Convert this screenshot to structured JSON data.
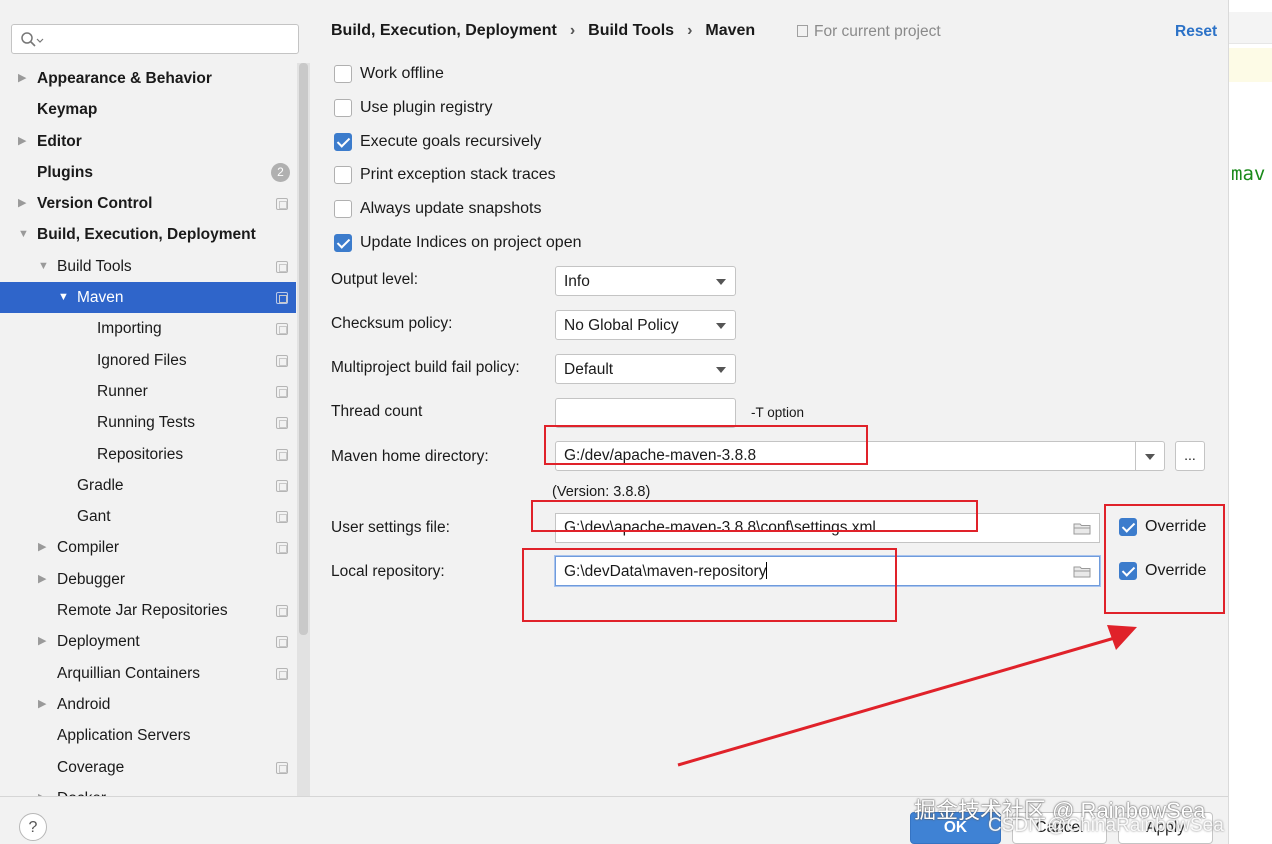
{
  "sidebar": {
    "search": {
      "placeholder": ""
    },
    "items": [
      {
        "label": "Appearance & Behavior",
        "bold": true,
        "arrow": "right",
        "depth": 0
      },
      {
        "label": "Keymap",
        "bold": true,
        "arrow": "",
        "depth": 0
      },
      {
        "label": "Editor",
        "bold": true,
        "arrow": "right",
        "depth": 0
      },
      {
        "label": "Plugins",
        "bold": true,
        "arrow": "",
        "depth": 0,
        "badge": "2"
      },
      {
        "label": "Version Control",
        "bold": true,
        "arrow": "right",
        "depth": 0,
        "icon": true
      },
      {
        "label": "Build, Execution, Deployment",
        "bold": true,
        "arrow": "down",
        "depth": 0
      },
      {
        "label": "Build Tools",
        "bold": false,
        "arrow": "down",
        "depth": 1,
        "icon": true
      },
      {
        "label": "Maven",
        "bold": false,
        "arrow": "down",
        "depth": 2,
        "icon": true,
        "selected": true
      },
      {
        "label": "Importing",
        "bold": false,
        "arrow": "",
        "depth": 3,
        "icon": true
      },
      {
        "label": "Ignored Files",
        "bold": false,
        "arrow": "",
        "depth": 3,
        "icon": true
      },
      {
        "label": "Runner",
        "bold": false,
        "arrow": "",
        "depth": 3,
        "icon": true
      },
      {
        "label": "Running Tests",
        "bold": false,
        "arrow": "",
        "depth": 3,
        "icon": true
      },
      {
        "label": "Repositories",
        "bold": false,
        "arrow": "",
        "depth": 3,
        "icon": true
      },
      {
        "label": "Gradle",
        "bold": false,
        "arrow": "",
        "depth": 2,
        "icon": true
      },
      {
        "label": "Gant",
        "bold": false,
        "arrow": "",
        "depth": 2,
        "icon": true
      },
      {
        "label": "Compiler",
        "bold": false,
        "arrow": "right",
        "depth": 1,
        "icon": true
      },
      {
        "label": "Debugger",
        "bold": false,
        "arrow": "right",
        "depth": 1
      },
      {
        "label": "Remote Jar Repositories",
        "bold": false,
        "arrow": "",
        "depth": 1,
        "icon": true
      },
      {
        "label": "Deployment",
        "bold": false,
        "arrow": "right",
        "depth": 1,
        "icon": true
      },
      {
        "label": "Arquillian Containers",
        "bold": false,
        "arrow": "",
        "depth": 1,
        "icon": true
      },
      {
        "label": "Android",
        "bold": false,
        "arrow": "right",
        "depth": 1
      },
      {
        "label": "Application Servers",
        "bold": false,
        "arrow": "",
        "depth": 1
      },
      {
        "label": "Coverage",
        "bold": false,
        "arrow": "",
        "depth": 1,
        "icon": true
      },
      {
        "label": "Docker",
        "bold": false,
        "arrow": "right",
        "depth": 1
      }
    ]
  },
  "breadcrumb": {
    "parts": [
      "Build, Execution, Deployment",
      "Build Tools",
      "Maven"
    ],
    "separator": "›",
    "scope": "For current project",
    "reset_label": "Reset"
  },
  "options": {
    "work_offline": {
      "label": "Work offline",
      "checked": false
    },
    "use_plugin_registry": {
      "label": "Use plugin registry",
      "checked": false
    },
    "execute_goals_recursively": {
      "label": "Execute goals recursively",
      "checked": true
    },
    "print_exception_stack_traces": {
      "label": "Print exception stack traces",
      "checked": false
    },
    "always_update_snapshots": {
      "label": "Always update snapshots",
      "checked": false
    },
    "update_indices": {
      "label": "Update Indices on project open",
      "checked": true
    }
  },
  "fields": {
    "output_level": {
      "label": "Output level:",
      "value": "Info"
    },
    "checksum_policy": {
      "label": "Checksum policy:",
      "value": "No Global Policy"
    },
    "fail_policy": {
      "label": "Multiproject build fail policy:",
      "value": "Default"
    },
    "thread_count": {
      "label": "Thread count",
      "value": "",
      "hint": "-T option"
    },
    "maven_home": {
      "label": "Maven home directory:",
      "value": "G:/dev/apache-maven-3.8.8",
      "version": "(Version: 3.8.8)",
      "browse_label": "..."
    },
    "user_settings": {
      "label": "User settings file:",
      "value": "G:\\dev\\apache-maven-3.8.8\\conf\\settings.xml",
      "override_label": "Override",
      "override": true
    },
    "local_repo": {
      "label": "Local repository:",
      "value": "G:\\devData\\maven-repository",
      "override_label": "Override",
      "override": true
    }
  },
  "buttons": {
    "help": "?",
    "ok": "OK",
    "cancel": "Cancel",
    "apply": "Apply"
  },
  "editor": {
    "code_fragment": "mav"
  },
  "watermarks": {
    "line1": "掘金技术社区 @ RainbowSea",
    "line2": "CSDN @ChinaRainbowSea"
  },
  "colors": {
    "selection": "#2f65ca",
    "accent": "#3c7ccc",
    "annotation": "#e0222a",
    "code_green": "#1a8a1a"
  }
}
